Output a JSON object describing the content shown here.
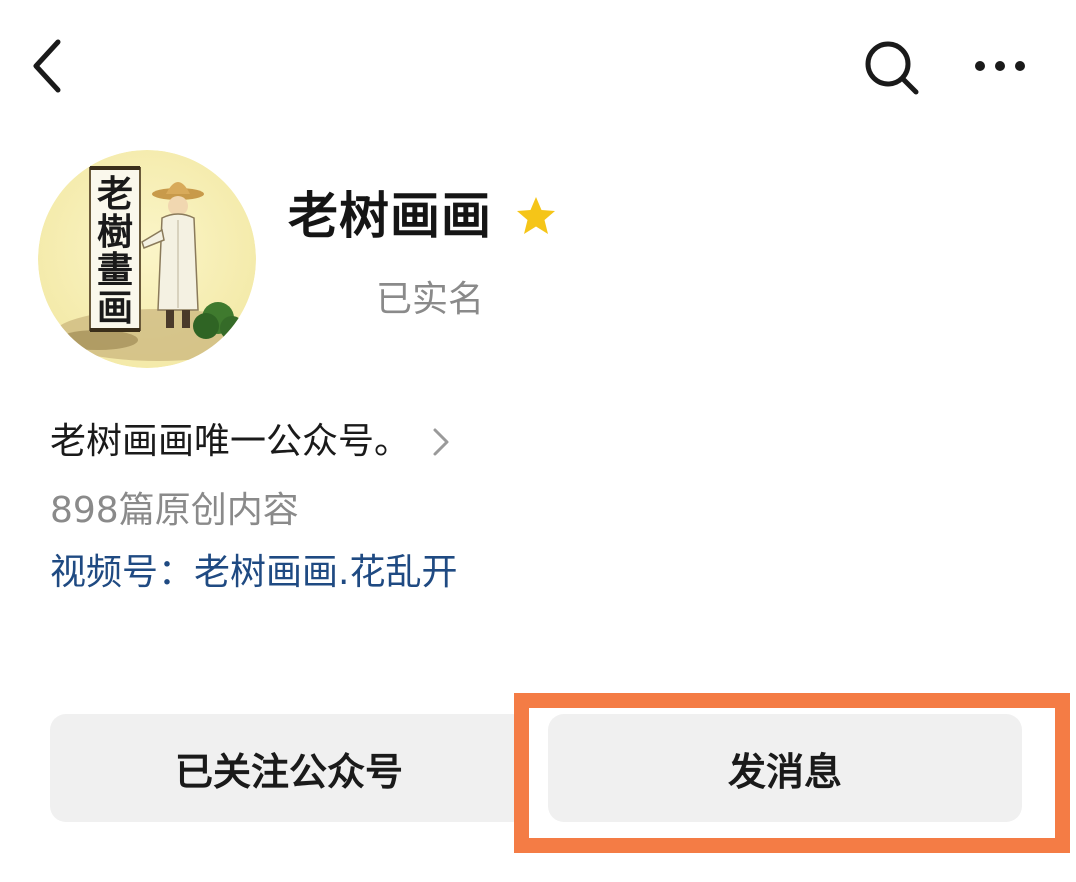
{
  "topbar": {
    "back_icon": "chevron-left-icon",
    "search_icon": "search-icon",
    "more_icon": "more-horizontal-icon"
  },
  "profile": {
    "avatar_icon": "account-avatar",
    "avatar_text": "老樹畫画",
    "name": "老树画画",
    "star_icon": "star-icon",
    "star_color": "#f5c518",
    "verification": "已实名"
  },
  "intro": {
    "text": "老树画画唯一公众号。",
    "chevron_icon": "chevron-right-icon"
  },
  "stats": {
    "original_count": "898篇原创内容"
  },
  "channel": {
    "text": "视频号：老树画画.花乱开",
    "color": "#1f4a82"
  },
  "actions": {
    "followed_label": "已关注公众号",
    "message_label": "发消息"
  },
  "annotation": {
    "highlight_color": "#f47c45"
  }
}
